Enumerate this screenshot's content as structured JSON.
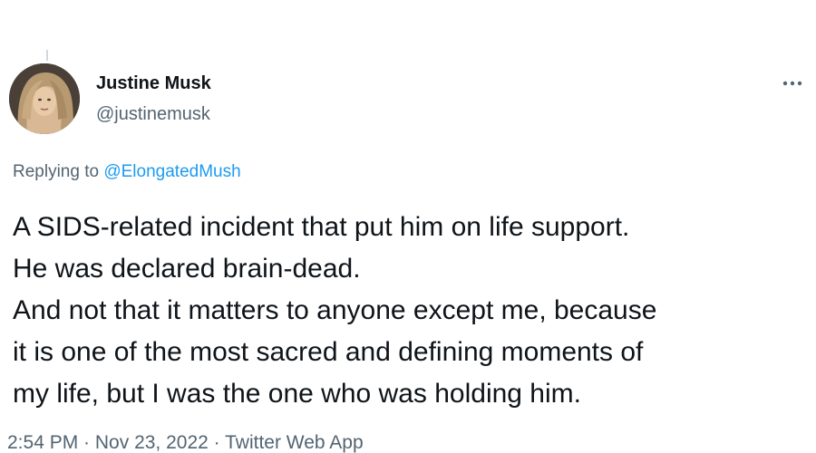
{
  "author": {
    "name": "Justine Musk",
    "handle": "@justinemusk"
  },
  "reply": {
    "prefix": "Replying to ",
    "mention": "@ElongatedMush"
  },
  "tweet": {
    "lines": [
      "A SIDS-related incident that put him on life support.",
      "He was declared brain-dead.",
      "And not that it matters to anyone except me, because",
      "it is one of the most sacred and defining moments of",
      "my life, but I was the one who was holding him."
    ]
  },
  "meta": {
    "time": "2:54 PM",
    "separator": " · ",
    "date": "Nov 23, 2022",
    "source": "Twitter Web App"
  },
  "icons": {
    "more": "more-horizontal-icon"
  },
  "colors": {
    "text_primary": "#0f1419",
    "text_secondary": "#536471",
    "link": "#1d9bf0"
  }
}
